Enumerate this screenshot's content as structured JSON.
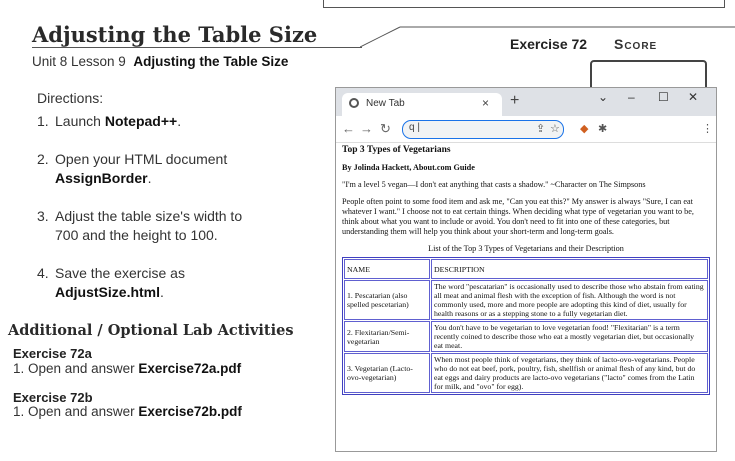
{
  "header": {
    "title": "Adjusting the Table Size",
    "unit_prefix": "Unit 8 Lesson 9",
    "unit_bold": "Adjusting the Table Size",
    "exercise": "Exercise 72",
    "score": "Score"
  },
  "directions": {
    "label": "Directions:",
    "steps": [
      {
        "num": "1.",
        "pre": "Launch ",
        "bold": "Notepad++",
        "post": "."
      },
      {
        "num": "2.",
        "pre": "Open your HTML document",
        "bold": "AssignBorder",
        "post": "."
      },
      {
        "num": "3.",
        "pre": "Adjust the table size's width to",
        "line2": "700 and the height to 100."
      },
      {
        "num": "4.",
        "pre": "Save the exercise as",
        "bold": "AdjustSize.html",
        "post": "."
      }
    ]
  },
  "additional": {
    "title": "Additional / Optional Lab Activities",
    "items": [
      {
        "heading": "Exercise 72a",
        "num": "1.",
        "text": "Open and answer ",
        "bold": "Exercise72a.pdf"
      },
      {
        "heading": "Exercise 72b",
        "num": "1.",
        "text": "Open and answer ",
        "bold": "Exercise72b.pdf"
      }
    ]
  },
  "browser": {
    "tab_title": "New Tab",
    "tab_close": "×",
    "new_tab": "+",
    "search_value": "q |",
    "page": {
      "heading": "Top 3 Types of Vegetarians",
      "byline": "By Jolinda Hackett, About.com Guide",
      "quote": "\"I'm a level 5 vegan—I don't eat anything that casts a shadow.\" ~Character on The Simpsons",
      "intro": "People often point to some food item and ask me, \"Can you eat this?\" My answer is always \"Sure, I can eat whatever I want.\" I choose not to eat certain things. When deciding what type of vegetarian you want to be, think about what you want to include or avoid. You don't need to fit into one of these categories, but understanding them will help you think about your short-term and long-term goals.",
      "caption": "List of the Top 3 Types of Vegetarians and their Description",
      "table_headers": [
        "NAME",
        "DESCRIPTION"
      ],
      "rows": [
        [
          "1. Pescatarian (also spelled pescetarian)",
          "The word \"pescatarian\" is occasionally used to describe those who abstain from eating all meat and animal flesh with the exception of fish. Although the word is not commonly used, more and more people are adopting this kind of diet, usually for health reasons or as a stepping stone to a fully vegetarian diet."
        ],
        [
          "2. Flexitarian/Semi-vegetarian",
          "You don't have to be vegetarian to love vegetarian food! \"Flexitarian\" is a term recently coined to describe those who eat a mostly vegetarian diet, but occasionally eat meat."
        ],
        [
          "3. Vegetarian (Lacto-ovo-vegetarian)",
          "When most people think of vegetarians, they think of lacto-ovo-vegetarians. People who do not eat beef, pork, poultry, fish, shellfish or animal flesh of any kind, but do eat eggs and dairy products are lacto-ovo vegetarians (\"lacto\" comes from the Latin for milk, and \"ovo\" for egg)."
        ]
      ]
    }
  }
}
